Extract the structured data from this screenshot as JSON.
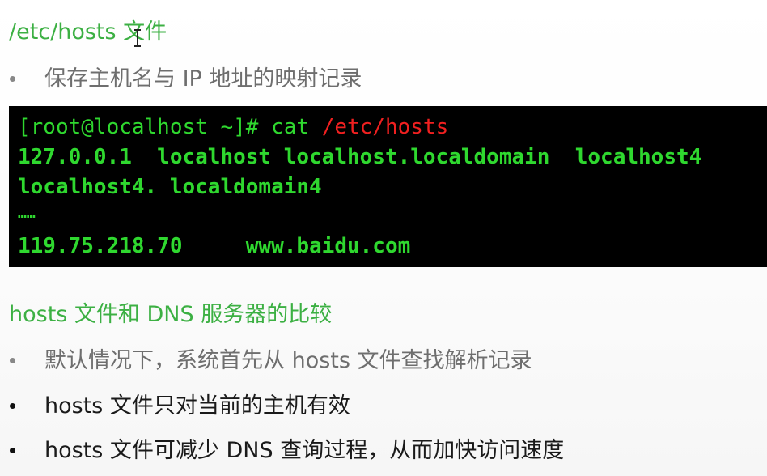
{
  "heading1": "/etc/hosts 文件",
  "bullet1": "保存主机名与 IP 地址的映射记录",
  "terminal": {
    "prompt": "[root@localhost ~]# cat ",
    "command_arg": "/etc/hosts",
    "line2": "127.0.0.1  localhost localhost.localdomain  localhost4",
    "line3": "localhost4. localdomain4",
    "line4": "……",
    "line5": "119.75.218.70     www.baidu.com"
  },
  "heading2": "hosts 文件和 DNS 服务器的比较",
  "bullets": [
    "默认情况下，系统首先从 hosts 文件查找解析记录",
    "hosts 文件只对当前的主机有效",
    "hosts 文件可减少 DNS 查询过程，从而加快访问速度"
  ],
  "colors": {
    "heading_green": "#3cb043",
    "terminal_green": "#2fd82f",
    "terminal_red": "#f02020",
    "terminal_bg": "#000000"
  },
  "icons": [
    "text-cursor-icon",
    "bullet-icon"
  ]
}
